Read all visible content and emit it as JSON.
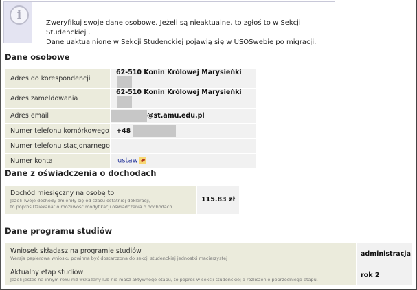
{
  "info": {
    "icon": "info-icon",
    "line1": "Zweryfikuj swoje dane osobowe. Jeżeli są nieaktualne, to zgłoś to w Sekcji Studenckiej .",
    "line2": "Dane uaktualnione w Sekcji Studenckiej pojawią się w USOSwebie po migracji."
  },
  "personal": {
    "title": "Dane osobowe",
    "rows": [
      {
        "label": "Adres do korespondencji",
        "value": "62-510 Konin Królowej Marysieńki"
      },
      {
        "label": "Adres zameldowania",
        "value": "62-510 Konin Królowej Marysieńki"
      },
      {
        "label": "Adres email",
        "value": "@st.amu.edu.pl"
      },
      {
        "label": "Numer telefonu komórkowego",
        "value": "+48"
      },
      {
        "label": "Numer telefonu stacjonarnego",
        "value": ""
      },
      {
        "label": "Numer konta",
        "value": "ustaw"
      }
    ]
  },
  "income": {
    "title": "Dane z oświadczenia o dochodach",
    "label": "Dochód miesięczny na osobę to",
    "note1": "Jeżeli Twoje dochody zmieniły się od czasu ostatniej deklaracji,",
    "note2": "to poproś Dziekanat o możliwość modyfikacji oświadczenia o dochodach.",
    "value": "115.83 zł"
  },
  "program": {
    "title": "Dane programu studiów",
    "rows": [
      {
        "label": "Wniosek składasz na programie studiów",
        "note": "Wersja papierowa wniosku powinna być dostarczona do sekcji studenckiej jednostki macierzystej",
        "value": "administracja"
      },
      {
        "label": "Aktualny etap studiów",
        "note": "Jeżeli jesteś na innym roku niż wskazany lub nie masz aktywnego etapu, to poproś w sekcji studenckiej o rozliczenie poprzedniego etapu.",
        "value": "rok 2"
      }
    ]
  }
}
